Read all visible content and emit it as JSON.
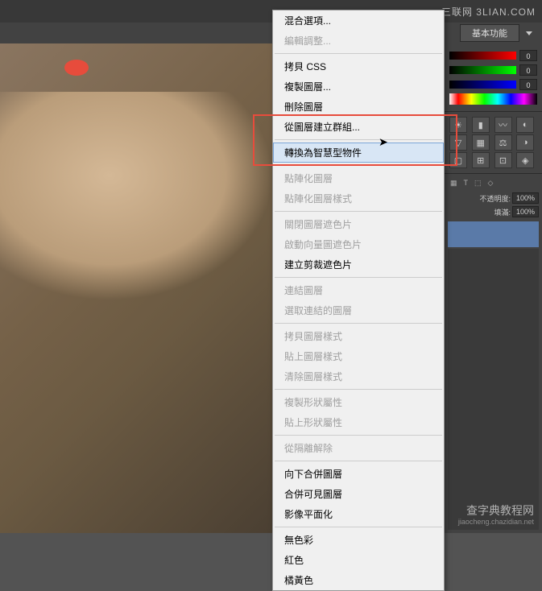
{
  "watermarks": {
    "top": "三联网 3LIAN.COM",
    "bottom_main": "查字典教程网",
    "bottom_sub": "jiaocheng.chazidian.net"
  },
  "workspace": {
    "label": "基本功能"
  },
  "color_panel": {
    "r": "0",
    "g": "0",
    "b": "0"
  },
  "layers_panel": {
    "opacity_label": "不透明度:",
    "opacity_value": "100%",
    "fill_label": "填滿:",
    "fill_value": "100%"
  },
  "context_menu": {
    "items": [
      {
        "label": "混合選項...",
        "enabled": true
      },
      {
        "label": "編輯調整...",
        "enabled": false
      },
      {
        "sep": true
      },
      {
        "label": "拷貝 CSS",
        "enabled": true
      },
      {
        "label": "複製圖層...",
        "enabled": true
      },
      {
        "label": "刪除圖層",
        "enabled": true
      },
      {
        "label": "從圖層建立群組...",
        "enabled": true
      },
      {
        "sep": true
      },
      {
        "label": "轉換為智慧型物件",
        "enabled": true,
        "highlighted": true
      },
      {
        "sep": true
      },
      {
        "label": "點陣化圖層",
        "enabled": false
      },
      {
        "label": "點陣化圖層樣式",
        "enabled": false
      },
      {
        "sep": true
      },
      {
        "label": "關閉圖層遮色片",
        "enabled": false
      },
      {
        "label": "啟動向量圖遮色片",
        "enabled": false
      },
      {
        "label": "建立剪裁遮色片",
        "enabled": true
      },
      {
        "sep": true
      },
      {
        "label": "連結圖層",
        "enabled": false
      },
      {
        "label": "選取連結的圖層",
        "enabled": false
      },
      {
        "sep": true
      },
      {
        "label": "拷貝圖層樣式",
        "enabled": false
      },
      {
        "label": "貼上圖層樣式",
        "enabled": false
      },
      {
        "label": "清除圖層樣式",
        "enabled": false
      },
      {
        "sep": true
      },
      {
        "label": "複製形狀屬性",
        "enabled": false
      },
      {
        "label": "貼上形狀屬性",
        "enabled": false
      },
      {
        "sep": true
      },
      {
        "label": "從隔離解除",
        "enabled": false
      },
      {
        "sep": true
      },
      {
        "label": "向下合併圖層",
        "enabled": true
      },
      {
        "label": "合併可見圖層",
        "enabled": true
      },
      {
        "label": "影像平面化",
        "enabled": true
      },
      {
        "sep": true
      },
      {
        "label": "無色彩",
        "enabled": true
      },
      {
        "label": "紅色",
        "enabled": true
      },
      {
        "label": "橘黃色",
        "enabled": true
      }
    ]
  }
}
